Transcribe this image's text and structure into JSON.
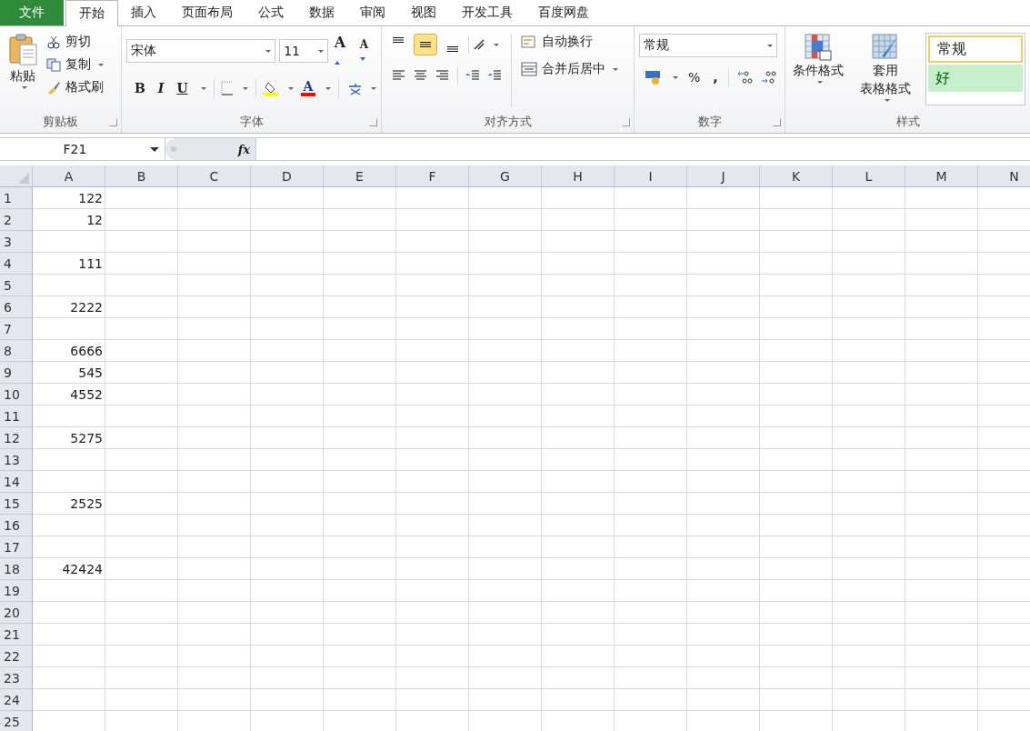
{
  "menu_tabs": [
    {
      "label": "文件",
      "kind": "file",
      "selected": false
    },
    {
      "label": "开始",
      "kind": "tab",
      "selected": true
    },
    {
      "label": "插入",
      "kind": "tab",
      "selected": false
    },
    {
      "label": "页面布局",
      "kind": "tab",
      "selected": false
    },
    {
      "label": "公式",
      "kind": "tab",
      "selected": false
    },
    {
      "label": "数据",
      "kind": "tab",
      "selected": false
    },
    {
      "label": "审阅",
      "kind": "tab",
      "selected": false
    },
    {
      "label": "视图",
      "kind": "tab",
      "selected": false
    },
    {
      "label": "开发工具",
      "kind": "tab",
      "selected": false
    },
    {
      "label": "百度网盘",
      "kind": "tab",
      "selected": false
    }
  ],
  "clipboard": {
    "paste": "粘贴",
    "cut": "剪切",
    "copy": "复制",
    "format_painter": "格式刷",
    "group_label": "剪贴板"
  },
  "font": {
    "font_name": "宋体",
    "font_size": "11",
    "grow": "A",
    "shrink": "A",
    "bold": "B",
    "italic": "I",
    "underline": "U",
    "font_color": "A",
    "group_label": "字体"
  },
  "alignment": {
    "vertical": [
      {
        "kind": "top",
        "selected": false
      },
      {
        "kind": "middle",
        "selected": true
      },
      {
        "kind": "bottom",
        "selected": false
      }
    ],
    "wrap_text": "自动换行",
    "merge_center": "合并后居中",
    "group_label": "对齐方式"
  },
  "number": {
    "format": "常规",
    "percent": "%",
    "comma": ",",
    "group_label": "数字"
  },
  "styles": {
    "conditional_format": "条件格式",
    "table_format_line1": "套用",
    "table_format_line2": "表格格式",
    "gallery": [
      {
        "label": "常规",
        "kind": "normal"
      },
      {
        "label": "好",
        "kind": "good"
      }
    ],
    "group_label": "样式"
  },
  "formula_bar": {
    "name_box": "F21",
    "fx": "fx"
  },
  "sheet": {
    "columns": [
      "A",
      "B",
      "C",
      "D",
      "E",
      "F",
      "G",
      "H",
      "I",
      "J",
      "K",
      "L",
      "M",
      "N"
    ],
    "rows": [
      {
        "number": "1",
        "a": "122"
      },
      {
        "number": "2",
        "a": "12"
      },
      {
        "number": "3"
      },
      {
        "number": "4",
        "a": "111"
      },
      {
        "number": "5"
      },
      {
        "number": "6",
        "a": "2222"
      },
      {
        "number": "7"
      },
      {
        "number": "8",
        "a": "6666"
      },
      {
        "number": "9",
        "a": "545"
      },
      {
        "number": "10",
        "a": "4552"
      },
      {
        "number": "11"
      },
      {
        "number": "12",
        "a": "5275"
      },
      {
        "number": "13"
      },
      {
        "number": "14"
      },
      {
        "number": "15",
        "a": "2525"
      },
      {
        "number": "16"
      },
      {
        "number": "17"
      },
      {
        "number": "18",
        "a": "42424"
      },
      {
        "number": "19"
      },
      {
        "number": "20"
      },
      {
        "number": "21"
      },
      {
        "number": "22"
      },
      {
        "number": "23"
      },
      {
        "number": "24"
      },
      {
        "number": "25"
      }
    ]
  }
}
